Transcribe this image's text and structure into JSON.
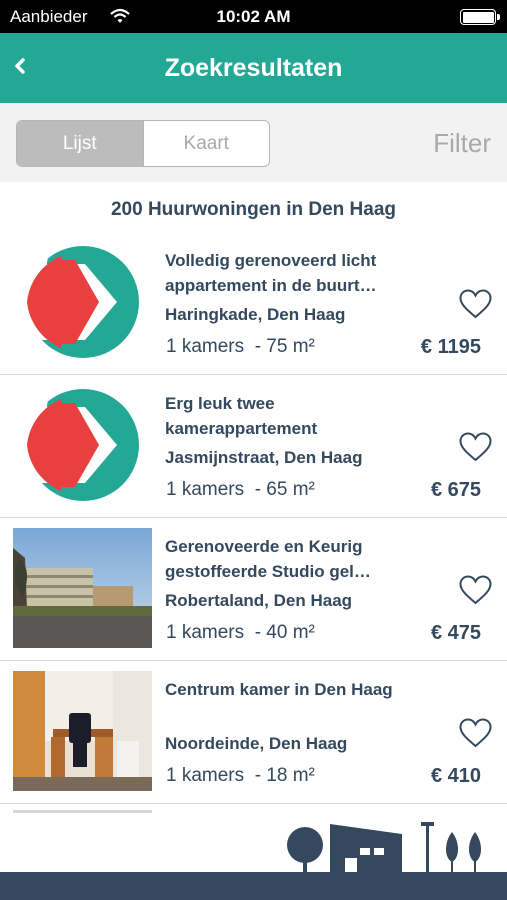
{
  "status_bar": {
    "carrier": "Aanbieder",
    "time": "10:02 AM"
  },
  "nav": {
    "title": "Zoekresultaten"
  },
  "view_toggle": {
    "list_label": "Lijst",
    "map_label": "Kaart"
  },
  "filter_label": "Filter",
  "results": {
    "count_text": "200 Huurwoningen in Den Haag",
    "items": [
      {
        "title": "Volledig gerenoveerd licht appartement in de buurt…",
        "street": "Haringkade, Den Haag",
        "rooms": "1 kamers",
        "area": "- 75 m²",
        "price": "€ 1195",
        "thumb": "logo"
      },
      {
        "title": "Erg leuk twee kamerappartement",
        "street": "Jasmijnstraat, Den Haag",
        "rooms": "1 kamers",
        "area": "- 65 m²",
        "price": "€ 675",
        "thumb": "logo"
      },
      {
        "title": "Gerenoveerde en Keurig gestoffeerde Studio gel…",
        "street": "Robertaland, Den Haag",
        "rooms": "1 kamers",
        "area": "- 40 m²",
        "price": "€ 475",
        "thumb": "photo-exterior"
      },
      {
        "title": "Centrum kamer in Den Haag",
        "street": "Noordeinde, Den Haag",
        "rooms": "1 kamers",
        "area": "- 18 m²",
        "price": "€ 410",
        "thumb": "photo-room"
      }
    ]
  },
  "colors": {
    "brand": "#23a896",
    "logo_red": "#e8403f",
    "dark": "#34495e"
  },
  "icons": {
    "back": "chevron-left-icon",
    "favorite": "heart-outline-icon",
    "wifi": "wifi-icon",
    "battery": "battery-icon"
  }
}
